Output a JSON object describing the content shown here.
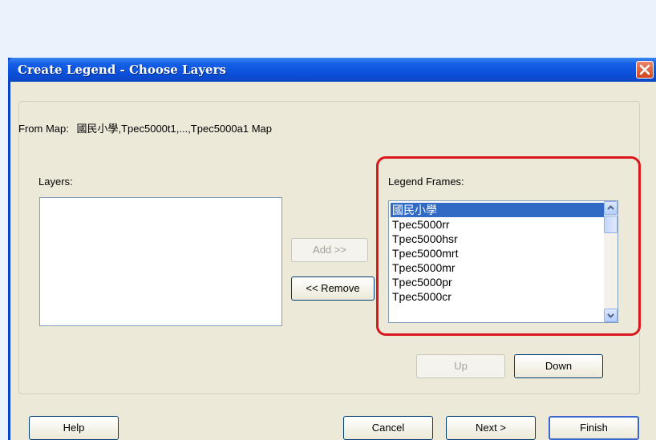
{
  "dialog": {
    "title": "Create Legend - Choose Layers",
    "from_map_label": "From Map:",
    "from_map_value": "國民小學,Tpec5000t1,...,Tpec5000a1 Map"
  },
  "layers": {
    "label": "Layers:",
    "items": []
  },
  "legend_frames": {
    "label": "Legend Frames:",
    "items": [
      "國民小學",
      "Tpec5000rr",
      "Tpec5000hsr",
      "Tpec5000mrt",
      "Tpec5000mr",
      "Tpec5000pr",
      "Tpec5000cr"
    ],
    "selected_index": 0
  },
  "buttons": {
    "add": "Add >>",
    "remove": "<< Remove",
    "up": "Up",
    "down": "Down",
    "help": "Help",
    "cancel": "Cancel",
    "next": "Next >",
    "finish": "Finish"
  },
  "icons": {
    "close": "close-icon",
    "scroll_up": "chevron-up-icon",
    "scroll_down": "chevron-down-icon"
  },
  "colors": {
    "title_bar": "#0a4ed8",
    "close_button": "#d2431c",
    "selection": "#316ac5",
    "highlight_border": "#d9171c",
    "dialog_face": "#ece9d8"
  }
}
